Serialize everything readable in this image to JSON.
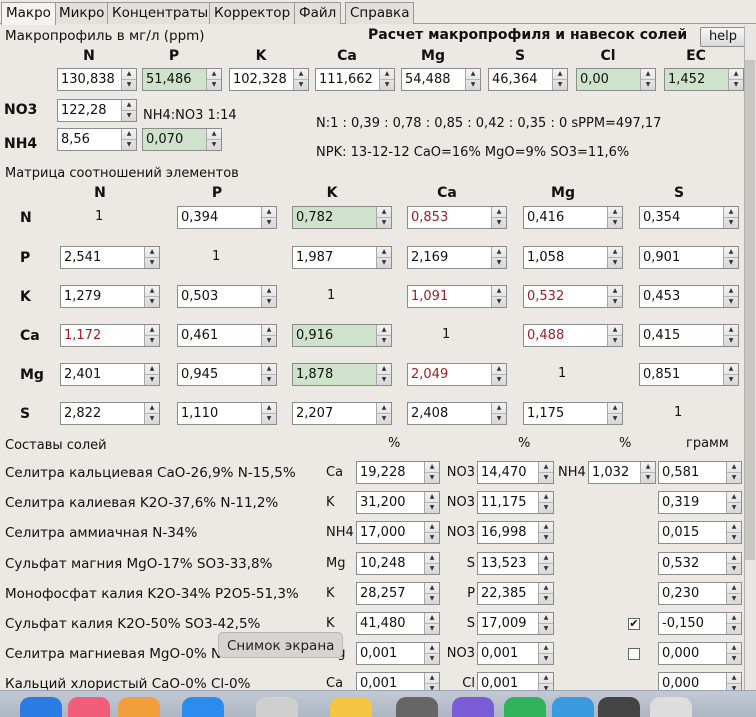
{
  "tabs": [
    "Макро",
    "Микро",
    "Концентраты",
    "Корректор",
    "Файл",
    "Справка"
  ],
  "macro": {
    "title_left": "Макропрофиль в мг/л (ppm)",
    "title_right": "Расчет макропрофиля и навесок солей",
    "help": "help",
    "headers": [
      "N",
      "P",
      "K",
      "Ca",
      "Mg",
      "S",
      "Cl",
      "EC"
    ],
    "values": [
      "130,838",
      "51,486",
      "102,328",
      "111,662",
      "54,488",
      "46,364",
      "0,00",
      "1,452"
    ],
    "no3_label": "NO3",
    "no3_value": "122,28",
    "nh4_label": "NH4",
    "nh4_value": "8,56",
    "nh4_ratio_value": "0,070",
    "nh4_no3_text": "NH4:NO3 1:14",
    "ratio_line": "N:1 : 0,39 : 0,78 : 0,85 : 0,42 : 0,35 : 0 sPPM=497,17",
    "npk_line": "NPK: 13-12-12 CaO=16% MgO=9% SO3=11,6%"
  },
  "matrix": {
    "title": "Матрица соотношений элементов",
    "cols": [
      "N",
      "P",
      "K",
      "Ca",
      "Mg",
      "S"
    ],
    "rows": [
      {
        "label": "N",
        "cells": [
          "1",
          "0,394",
          "0,782",
          "0,853",
          "0,416",
          "0,354"
        ]
      },
      {
        "label": "P",
        "cells": [
          "2,541",
          "1",
          "1,987",
          "2,169",
          "1,058",
          "0,901"
        ]
      },
      {
        "label": "K",
        "cells": [
          "1,279",
          "0,503",
          "1",
          "1,091",
          "0,532",
          "0,453"
        ]
      },
      {
        "label": "Ca",
        "cells": [
          "1,172",
          "0,461",
          "0,916",
          "1",
          "0,488",
          "0,415"
        ]
      },
      {
        "label": "Mg",
        "cells": [
          "2,401",
          "0,945",
          "1,878",
          "2,049",
          "1",
          "0,851"
        ]
      },
      {
        "label": "S",
        "cells": [
          "2,822",
          "1,110",
          "2,207",
          "2,408",
          "1,175",
          "1"
        ]
      }
    ]
  },
  "salts": {
    "title": "Составы солей",
    "pct1": "%",
    "pct2": "%",
    "pct3": "%",
    "gram": "грамм",
    "rows": [
      {
        "name": "Селитра кальциевая CaO-26,9% N-15,5%",
        "el1": "Ca",
        "v1": "19,228",
        "el2": "NO3",
        "v2": "14,470",
        "el3": "NH4",
        "v3": "1,032",
        "check": "",
        "gram": "0,581"
      },
      {
        "name": "Селитра калиевая K2O-37,6% N-11,2%",
        "el1": "K",
        "v1": "31,200",
        "el2": "NO3",
        "v2": "11,175",
        "el3": "",
        "v3": "",
        "check": "",
        "gram": "0,319"
      },
      {
        "name": "Селитра аммиачная N-34%",
        "el1": "NH4",
        "v1": "17,000",
        "el2": "NO3",
        "v2": "16,998",
        "el3": "",
        "v3": "",
        "check": "",
        "gram": "0,015"
      },
      {
        "name": "Сульфат магния MgO-17% SO3-33,8%",
        "el1": "Mg",
        "v1": "10,248",
        "el2": "S",
        "v2": "13,523",
        "el3": "",
        "v3": "",
        "check": "",
        "gram": "0,532"
      },
      {
        "name": "Монофосфат калия K2O-34% P2O5-51,3%",
        "el1": "K",
        "v1": "28,257",
        "el2": "P",
        "v2": "22,385",
        "el3": "",
        "v3": "",
        "check": "",
        "gram": "0,230"
      },
      {
        "name": "Сульфат калия K2O-50% SO3-42,5%",
        "el1": "K",
        "v1": "41,480",
        "el2": "S",
        "v2": "17,009",
        "el3": "",
        "v3": "",
        "check": "✔",
        "gram": "-0,150"
      },
      {
        "name": "Селитра магниевая MgO-0% N-0%",
        "el1": "Mg",
        "v1": "0,001",
        "el2": "NO3",
        "v2": "0,001",
        "el3": "",
        "v3": "",
        "check": "",
        "gram": "0,000"
      },
      {
        "name": "Кальций хлористый CaO-0% Cl-0%",
        "el1": "Ca",
        "v1": "0,001",
        "el2": "Cl",
        "v2": "0,001",
        "el3": "",
        "v3": "",
        "check": "",
        "gram": "0,000"
      }
    ]
  },
  "tooltip": "Снимок экрана",
  "colors": {
    "green": "#cfe3cc",
    "red_text": "#a02020"
  }
}
